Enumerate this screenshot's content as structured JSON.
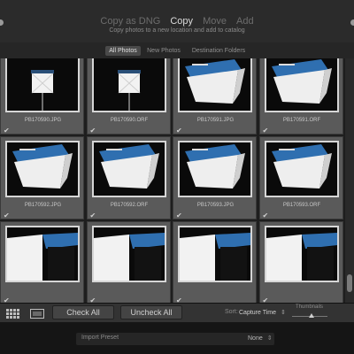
{
  "header": {
    "modes": [
      {
        "label": "Copy as DNG",
        "active": false
      },
      {
        "label": "Copy",
        "active": true
      },
      {
        "label": "Move",
        "active": false
      },
      {
        "label": "Add",
        "active": false
      }
    ],
    "subtitle": "Copy photos to a new location and add to catalog"
  },
  "filters": [
    {
      "label": "All Photos",
      "active": true
    },
    {
      "label": "New Photos",
      "active": false
    },
    {
      "label": "Destination Folders",
      "active": false
    }
  ],
  "photos": [
    {
      "name": "PB170590.JPG",
      "checked": true,
      "subject": "lightbox"
    },
    {
      "name": "PB170590.ORF",
      "checked": true,
      "subject": "lightbox"
    },
    {
      "name": "PB170591.JPG",
      "checked": true,
      "subject": "bag"
    },
    {
      "name": "PB170591.ORF",
      "checked": true,
      "subject": "bag"
    },
    {
      "name": "PB170592.JPG",
      "checked": true,
      "subject": "bag"
    },
    {
      "name": "PB170592.ORF",
      "checked": true,
      "subject": "bag"
    },
    {
      "name": "PB170593.JPG",
      "checked": true,
      "subject": "bag"
    },
    {
      "name": "PB170593.ORF",
      "checked": true,
      "subject": "bag"
    },
    {
      "name": "",
      "checked": true,
      "subject": "closeup"
    },
    {
      "name": "",
      "checked": true,
      "subject": "closeup"
    },
    {
      "name": "",
      "checked": true,
      "subject": "closeup"
    },
    {
      "name": "",
      "checked": true,
      "subject": "closeup"
    }
  ],
  "toolbar": {
    "check_all": "Check All",
    "uncheck_all": "Uncheck All",
    "sort_label": "Sort:",
    "sort_value": "Capture Time",
    "thumbnails_label": "Thumbnails",
    "thumbnail_size": 0.5
  },
  "bottom": {
    "preset_label": "Import Preset",
    "preset_value": "None"
  },
  "colors": {
    "active_text": "#dcdcdc",
    "inactive_text": "#6d6d6d",
    "cell_bg": "#5a5a5a",
    "bag_blue": "#2f6fb0"
  }
}
